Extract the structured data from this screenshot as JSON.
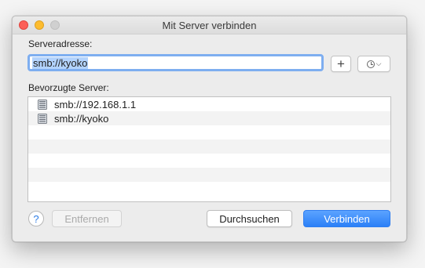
{
  "window": {
    "title": "Mit Server verbinden"
  },
  "server_address": {
    "label": "Serveradresse:",
    "value": "smb://kyoko"
  },
  "add_button": {
    "label": "+"
  },
  "history_button": {
    "icon": "clock-icon"
  },
  "favorites": {
    "label": "Bevorzugte Server:",
    "items": [
      {
        "label": "smb://192.168.1.1",
        "icon": "server-icon"
      },
      {
        "label": "smb://kyoko",
        "icon": "server-icon"
      }
    ],
    "empty_rows": 5
  },
  "help_button": {
    "label": "?"
  },
  "buttons": {
    "remove": "Entfernen",
    "browse": "Durchsuchen",
    "connect": "Verbinden"
  },
  "colors": {
    "accent": "#2b80f7",
    "close": "#fc5f57",
    "minimize": "#fdbc2e"
  }
}
